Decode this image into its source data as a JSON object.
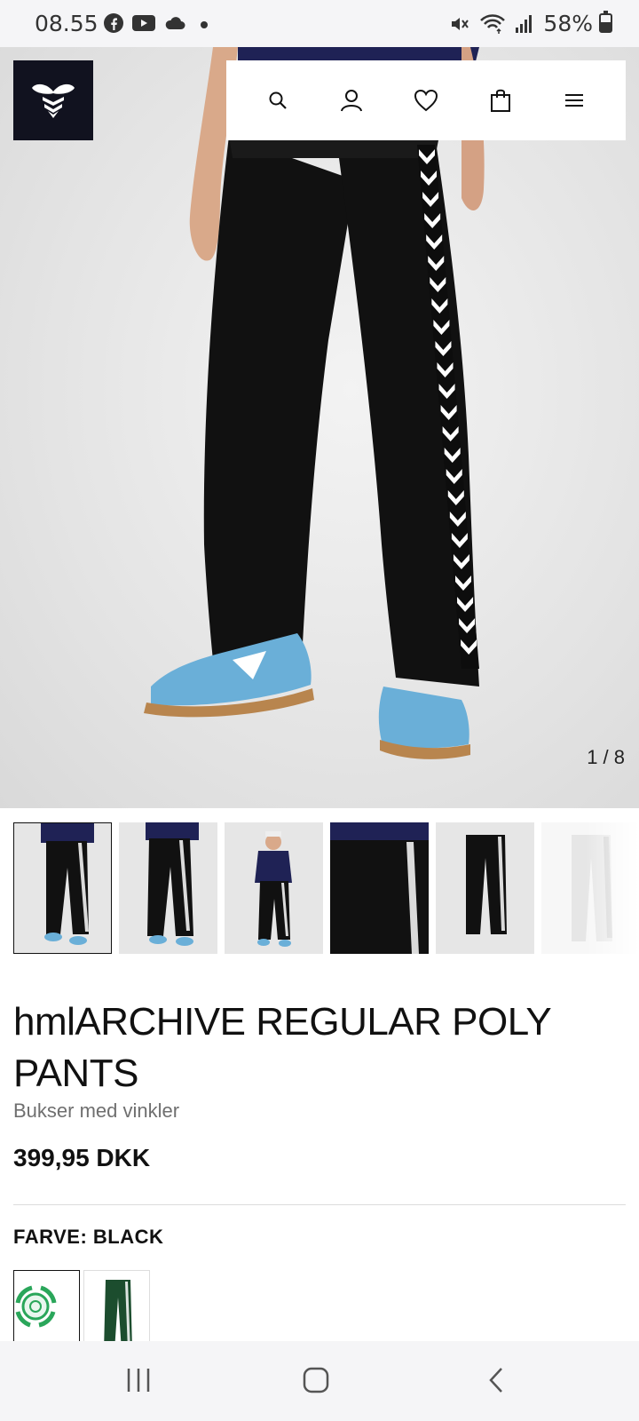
{
  "status_bar": {
    "time": "08.55",
    "battery_percent": "58%",
    "battery_level": 0.58,
    "left_icons": [
      "facebook-icon",
      "youtube-icon",
      "cloud-icon",
      "dot-icon"
    ],
    "right_icons": [
      "mute-icon",
      "wifi-icon",
      "signal-icon",
      "battery-icon"
    ]
  },
  "header": {
    "logo": "hummel-bee-logo",
    "nav_icons": [
      "search-icon",
      "account-icon",
      "wishlist-heart-icon",
      "cart-bag-icon",
      "menu-icon"
    ]
  },
  "gallery": {
    "counter": "1 / 8",
    "current": 1,
    "total": 8,
    "thumbnails": [
      "front-view",
      "back-view",
      "full-body-view",
      "close-up-view",
      "flat-product-view",
      "flat-product-view-light"
    ]
  },
  "product": {
    "title": "hmlARCHIVE REGULAR POLY PANTS",
    "subtitle": "Bukser med vinkler",
    "price": "399,95 DKK",
    "color_label": "FARVE: BLACK",
    "swatches": [
      "recycled-badge",
      "green-pants"
    ]
  },
  "colors": {
    "logo_bg": "#11121f",
    "pants": "#111111",
    "shoe_blue": "#6aafd8",
    "swatch_green": "#1c4d2e",
    "recycle_green": "#2aa65a"
  },
  "system_nav": [
    "recents-icon",
    "home-icon",
    "back-icon"
  ]
}
